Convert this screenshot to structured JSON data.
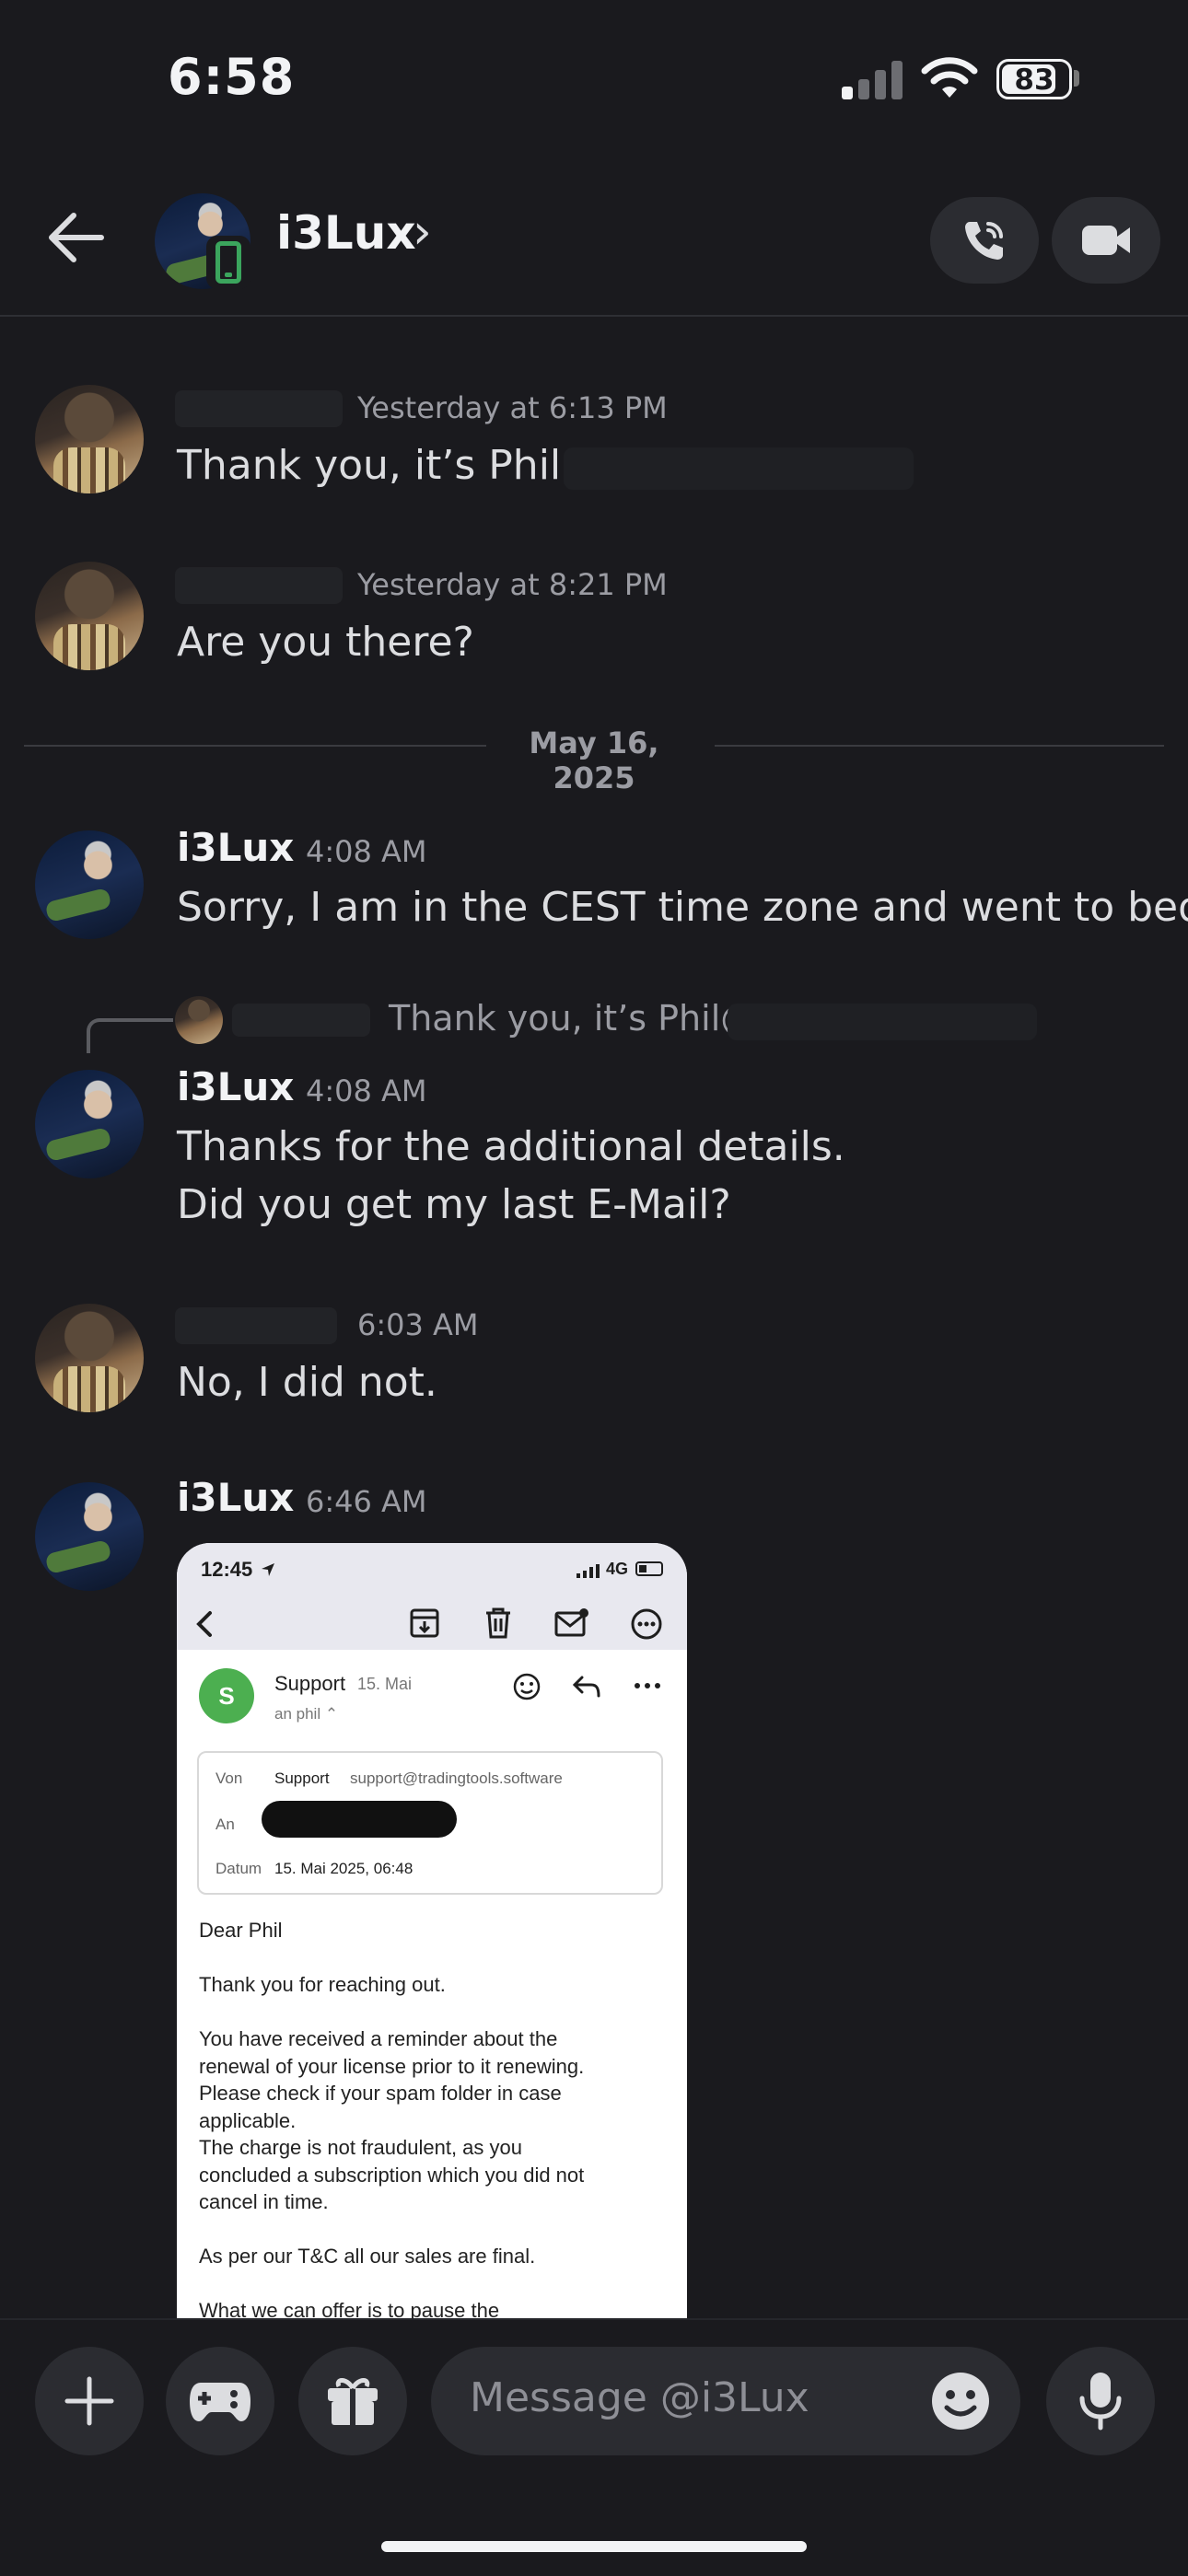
{
  "status_bar": {
    "time": "6:58",
    "battery": "83",
    "battery_level": 0.83
  },
  "header": {
    "contact_name": "i3Lux",
    "chevron": "›"
  },
  "date_separator": "May 16, 2025",
  "messages": [
    {
      "author": "",
      "timestamp": "Yesterday at 6:13 PM",
      "text": "Thank you, it’s Phil@"
    },
    {
      "author": "",
      "timestamp": "Yesterday at 8:21 PM",
      "text": "Are you there?"
    },
    {
      "author": "i3Lux",
      "timestamp": "4:08 AM",
      "text": "Sorry, I am in the CEST time zone and went to bed."
    },
    {
      "author": "i3Lux",
      "timestamp": "4:08 AM",
      "reply_preview": "Thank you, it’s Phil@",
      "lines": [
        "Thanks for the additional details.",
        "Did you get my last E-Mail?"
      ]
    },
    {
      "author": "",
      "timestamp": "6:03 AM",
      "text": "No, I did not."
    },
    {
      "author": "i3Lux",
      "timestamp": "6:46 AM"
    }
  ],
  "attachment": {
    "status_time": "12:45",
    "network": "4G",
    "sender_initial": "S",
    "sender": "Support",
    "sender_date": "15. Mai",
    "to_line": "an phil ⌃",
    "details": {
      "von_label": "Von",
      "von_name": "Support",
      "von_email": "support@tradingtools.software",
      "an_label": "An",
      "datum_label": "Datum",
      "datum_value": "15. Mai 2025, 06:48"
    },
    "body": {
      "greeting": "Dear Phil",
      "p1": "Thank you for reaching out.",
      "p2_lines": [
        "You have received a reminder about the",
        "renewal of your license prior to it renewing.",
        "Please check if your spam folder in case",
        "applicable."
      ],
      "p3_lines": [
        "The charge is not fraudulent, as you",
        "concluded a subscription which you did not",
        "cancel in time."
      ],
      "p4": "As per our T&C all our sales are final.",
      "p5": "What we can offer is to pause the"
    }
  },
  "composer": {
    "placeholder": "Message @i3Lux"
  },
  "colors": {
    "background": "#1a1a1e",
    "surface": "#2b2c31",
    "text": "#f2f3f5",
    "muted": "#9b9ca3",
    "mobile_status": "#3ba55d",
    "email_avatar": "#4caf50"
  }
}
